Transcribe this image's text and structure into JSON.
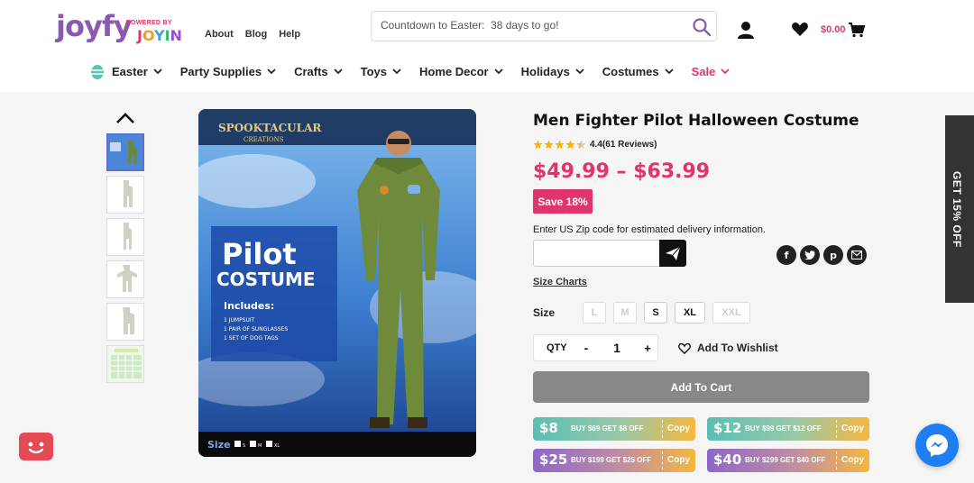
{
  "brand": {
    "logo_text": "joyfy",
    "powered_by": "POWERED BY",
    "sub_brand": "JOYIN"
  },
  "top_links": [
    "About",
    "Blog",
    "Help"
  ],
  "search": {
    "placeholder": "Countdown to Easter:  38 days to go!"
  },
  "cart": {
    "total": "$0.00"
  },
  "nav": [
    {
      "label": "Easter",
      "icon": "easter-egg-icon"
    },
    {
      "label": "Party Supplies"
    },
    {
      "label": "Crafts"
    },
    {
      "label": "Toys"
    },
    {
      "label": "Home Decor"
    },
    {
      "label": "Holidays"
    },
    {
      "label": "Costumes"
    },
    {
      "label": "Sale",
      "accent": "#e0356b"
    }
  ],
  "product": {
    "title": "Men Fighter Pilot Halloween Costume",
    "rating": 4.4,
    "rating_text": "4.4(61 Reviews)",
    "price": "$49.99 – $63.99",
    "save_badge": "Save 18%",
    "zip_label": "Enter US Zip code for estimated delivery information.",
    "size_charts": "Size Charts",
    "size_label": "Size",
    "sizes": [
      {
        "label": "L",
        "available": false
      },
      {
        "label": "M",
        "available": false
      },
      {
        "label": "S",
        "available": true
      },
      {
        "label": "XL",
        "available": true
      },
      {
        "label": "XXL",
        "available": false
      }
    ],
    "qty_label": "QTY",
    "qty_value": "1",
    "qty_minus": "-",
    "qty_plus": "+",
    "wishlist": "Add To Wishlist",
    "add_to_cart": "Add To Cart"
  },
  "image_text": {
    "brand_line1": "SPOOKTACULAR",
    "brand_line2": "CREATIONS",
    "pilot": "Pilot",
    "costume": "COSTUME",
    "includes": "Includes:",
    "items": [
      "1 JUMPSUIT",
      "1 PAIR OF SUNGLASSES",
      "1 SET OF DOG TAGS"
    ],
    "size": "Size",
    "size_marks": [
      "S",
      "M",
      "XL"
    ]
  },
  "coupons": [
    {
      "amount": "$8",
      "desc": "BUY $69 GET $8 OFF",
      "copy": "Copy",
      "from": "#5bbfb3",
      "to": "#f4b740"
    },
    {
      "amount": "$12",
      "desc": "BUY $99 GET $12 OFF",
      "copy": "Copy",
      "from": "#5bbfb3",
      "to": "#f4b740"
    },
    {
      "amount": "$25",
      "desc": "BUY $199 GET $25 OFF",
      "copy": "Copy",
      "from": "#8e66c9",
      "to": "#f4b740"
    },
    {
      "amount": "$40",
      "desc": "BUY $299 GET $40 OFF",
      "copy": "Copy",
      "from": "#8e66c9",
      "to": "#f4b740"
    }
  ],
  "side_tab": "GET 15% OFF",
  "colors": {
    "accent": "#e0356b",
    "brand_purple": "#8a5ab0",
    "button_gray": "#888888"
  }
}
